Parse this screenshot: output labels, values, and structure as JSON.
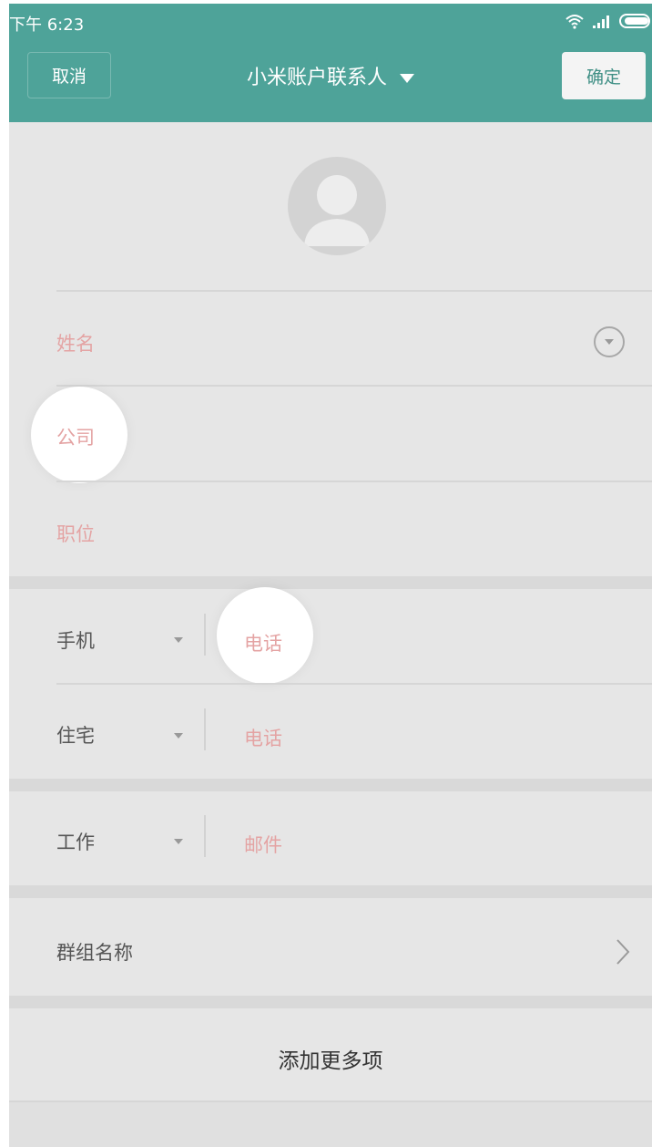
{
  "status_bar": {
    "time": "下午 6:23",
    "icons": [
      "wifi-icon",
      "signal-icon",
      "battery-icon"
    ]
  },
  "header": {
    "cancel_label": "取消",
    "title": "小米账户联系人",
    "confirm_label": "确定"
  },
  "fields": {
    "name_placeholder": "姓名",
    "company_placeholder": "公司",
    "title_placeholder": "职位"
  },
  "phones": [
    {
      "type": "手机",
      "placeholder": "电话"
    },
    {
      "type": "住宅",
      "placeholder": "电话"
    }
  ],
  "email": {
    "type": "工作",
    "placeholder": "邮件"
  },
  "group": {
    "label": "群组名称"
  },
  "add_more_label": "添加更多项",
  "colors": {
    "header_bg": "#4ea399",
    "placeholder": "#e4a3a3",
    "page_bg": "#e6e6e6"
  }
}
